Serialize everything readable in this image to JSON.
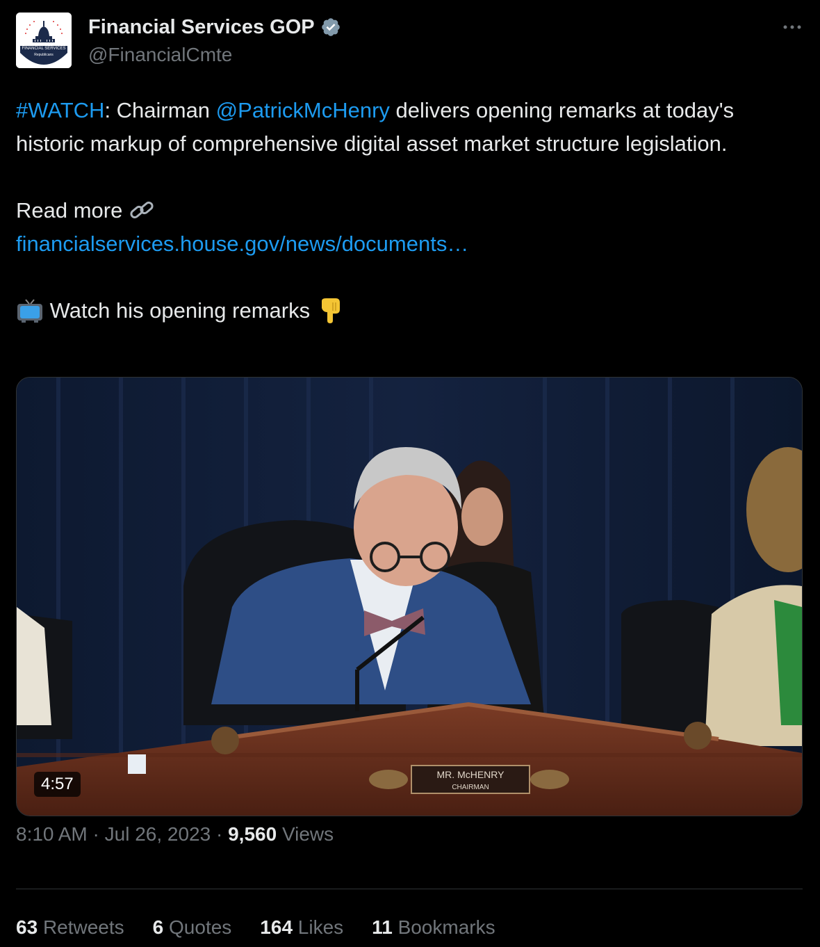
{
  "account": {
    "display_name": "Financial Services GOP",
    "handle": "@FinancialCmte",
    "avatar_line1": "FINANCIAL SERVICES",
    "avatar_line2": "Republicans"
  },
  "tweet": {
    "hashtag": "#WATCH",
    "text_1": ": Chairman ",
    "mention": "@PatrickMcHenry",
    "text_2": " delivers opening remarks at today's historic markup of comprehensive digital asset market structure legislation.",
    "read_more": "Read more",
    "link": "financialservices.house.gov/news/documents…",
    "watch_text": "Watch his opening remarks"
  },
  "media": {
    "duration": "4:57",
    "nameplate_line1": "MR. McHENRY",
    "nameplate_line2": "CHAIRMAN"
  },
  "meta": {
    "time": "8:10 AM",
    "separator": "·",
    "date": "Jul 26, 2023",
    "views_count": "9,560",
    "views_label": "Views"
  },
  "stats": [
    {
      "count": "63",
      "label": "Retweets"
    },
    {
      "count": "6",
      "label": "Quotes"
    },
    {
      "count": "164",
      "label": "Likes"
    },
    {
      "count": "11",
      "label": "Bookmarks"
    }
  ],
  "colors": {
    "background": "#000000",
    "text": "#e7e9ea",
    "secondary": "#71767b",
    "link": "#1d9bf0"
  }
}
